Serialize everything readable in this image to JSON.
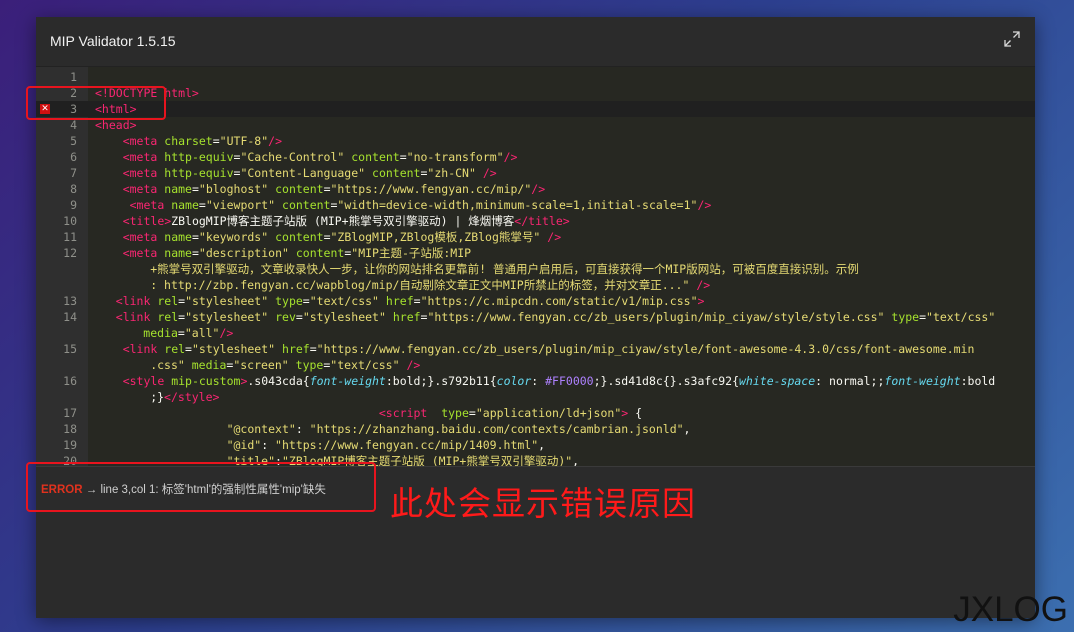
{
  "app": {
    "title": "MIP Validator 1.5.15"
  },
  "icons": {
    "expand": "expand-icon",
    "error": "error-marker-icon"
  },
  "colors": {
    "error": "#e0321e",
    "annotation": "#ff1a1a"
  },
  "editor": {
    "lines": [
      {
        "n": "1",
        "html": ""
      },
      {
        "n": "2",
        "html": "<span class='t'>&lt;!DOCTYPE html&gt;</span>"
      },
      {
        "n": "3",
        "html": "<span class='t'>&lt;html&gt;</span>",
        "error": true,
        "current": true
      },
      {
        "n": "4",
        "html": "<span class='t'>&lt;head&gt;</span>"
      },
      {
        "n": "5",
        "html": "    <span class='t'>&lt;meta</span> <span class='a'>charset</span>=<span class='s'>\"UTF-8\"</span><span class='t'>/&gt;</span>"
      },
      {
        "n": "6",
        "html": "    <span class='t'>&lt;meta</span> <span class='a'>http-equiv</span>=<span class='s'>\"Cache-Control\"</span> <span class='a'>content</span>=<span class='s'>\"no-transform\"</span><span class='t'>/&gt;</span>"
      },
      {
        "n": "7",
        "html": "    <span class='t'>&lt;meta</span> <span class='a'>http-equiv</span>=<span class='s'>\"Content-Language\"</span> <span class='a'>content</span>=<span class='s'>\"zh-CN\"</span> <span class='t'>/&gt;</span>"
      },
      {
        "n": "8",
        "html": "    <span class='t'>&lt;meta</span> <span class='a'>name</span>=<span class='s'>\"bloghost\"</span> <span class='a'>content</span>=<span class='s'>\"https://www.fengyan.cc/mip/\"</span><span class='t'>/&gt;</span>"
      },
      {
        "n": "9",
        "html": "     <span class='t'>&lt;meta</span> <span class='a'>name</span>=<span class='s'>\"viewport\"</span> <span class='a'>content</span>=<span class='s'>\"width=device-width,minimum-scale=1,initial-scale=1\"</span><span class='t'>/&gt;</span>"
      },
      {
        "n": "10",
        "html": "    <span class='t'>&lt;title&gt;</span>ZBlogMIP博客主题子站版 (MIP+熊掌号双引擎驱动) | 烽烟博客<span class='t'>&lt;/title&gt;</span>"
      },
      {
        "n": "11",
        "html": "    <span class='t'>&lt;meta</span> <span class='a'>name</span>=<span class='s'>\"keywords\"</span> <span class='a'>content</span>=<span class='s'>\"ZBlogMIP,ZBlog模板,ZBlog熊掌号\"</span> <span class='t'>/&gt;</span>"
      },
      {
        "n": "12",
        "html": "    <span class='t'>&lt;meta</span> <span class='a'>name</span>=<span class='s'>\"description\"</span> <span class='a'>content</span>=<span class='s'>\"MIP主题-子站版:MIP</span>",
        "cont": [
          "<span class='s'>+熊掌号双引擎驱动，文章收录快人一步，让你的网站排名更靠前! 普通用户启用后，可直接获得一个MIP版网站，可被百度直接识别。示例</span>",
          "<span class='s'>: http://zbp.fengyan.cc/wapblog/mip/自动剔除文章正文中MIP所禁止的标签，并对文章正...\"</span> <span class='t'>/&gt;</span>"
        ],
        "contIndent": [
          8,
          8
        ]
      },
      {
        "n": "13",
        "html": "   <span class='t'>&lt;link</span> <span class='a'>rel</span>=<span class='s'>\"stylesheet\"</span> <span class='a'>type</span>=<span class='s'>\"text/css\"</span> <span class='a'>href</span>=<span class='s'>\"https://c.mipcdn.com/static/v1/mip.css\"</span><span class='t'>&gt;</span>"
      },
      {
        "n": "14",
        "html": "   <span class='t'>&lt;link</span> <span class='a'>rel</span>=<span class='s'>\"stylesheet\"</span> <span class='a'>rev</span>=<span class='s'>\"stylesheet\"</span> <span class='a'>href</span>=<span class='s'>\"https://www.fengyan.cc/zb_users/plugin/mip_ciyaw/style/style.css\"</span> <span class='a'>type</span>=<span class='s'>\"text/css\"</span>",
        "cont": [
          "<span class='a'>media</span>=<span class='s'>\"all\"</span><span class='t'>/&gt;</span>"
        ],
        "contIndent": [
          7
        ]
      },
      {
        "n": "15",
        "html": "    <span class='t'>&lt;link</span> <span class='a'>rel</span>=<span class='s'>\"stylesheet\"</span> <span class='a'>href</span>=<span class='s'>\"https://www.fengyan.cc/zb_users/plugin/mip_ciyaw/style/font-awesome-4.3.0/css/font-awesome.min</span>",
        "cont": [
          "<span class='s'>.css\"</span> <span class='a'>media</span>=<span class='s'>\"screen\"</span> <span class='a'>type</span>=<span class='s'>\"text/css\"</span> <span class='t'>/&gt;</span>"
        ],
        "contIndent": [
          8
        ]
      },
      {
        "n": "16",
        "html": "    <span class='t'>&lt;style</span> <span class='a'>mip-custom</span><span class='t'>&gt;</span>.s043cda{<span class='i'>font-weight</span>:bold;}.s792b11{<span class='i'>color</span>: <span class='v'>#FF0000</span>;}.sd41d8c{}.s3afc92{<span class='i'>white-space</span>: normal;;<span class='i'>font-weight</span>:bold",
        "cont": [
          ";}<span class='t'>&lt;/style&gt;</span>"
        ],
        "contIndent": [
          8
        ]
      },
      {
        "n": "17",
        "html": "                                         <span class='t'>&lt;script</span>  <span class='a'>type</span>=<span class='s'>\"application/ld+json\"</span><span class='t'>&gt;</span> {"
      },
      {
        "n": "18",
        "html": "                   <span class='s'>\"@context\"</span>: <span class='s'>\"https://zhanzhang.baidu.com/contexts/cambrian.jsonld\"</span>,"
      },
      {
        "n": "19",
        "html": "                   <span class='s'>\"@id\"</span>: <span class='s'>\"https://www.fengyan.cc/mip/1409.html\"</span>,"
      },
      {
        "n": "20",
        "html": "                   <span class='s'>\"title\"</span>:<span class='s'>\"ZBlogMIP博客主题子站版 (MIP+熊掌号双引擎驱动)\"</span>,"
      }
    ]
  },
  "status": {
    "label": "ERROR",
    "arrow": "→",
    "message": "line 3,col 1: 标签'html'的强制性属性'mip'缺失"
  },
  "annotation": {
    "text": "此处会显示错误原因"
  },
  "watermark": {
    "text": "JXLOG"
  }
}
